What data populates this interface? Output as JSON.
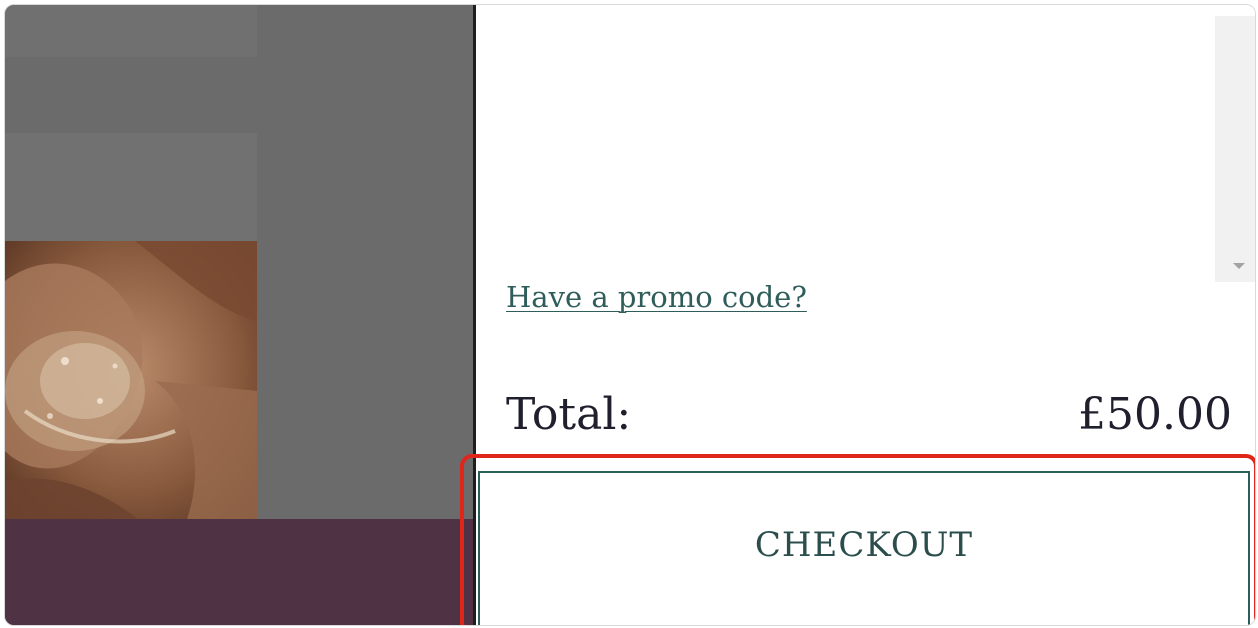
{
  "cart": {
    "promo_link": "Have a promo code?",
    "total_label": "Total:",
    "total_value": "£50.00",
    "checkout_label": "CHECKOUT"
  },
  "colors": {
    "accent": "#2b5e5a",
    "highlight": "#e0261b",
    "overlay_band": "#4f3243"
  },
  "icons": {
    "scroll_down": "scroll-down-arrow-icon"
  }
}
